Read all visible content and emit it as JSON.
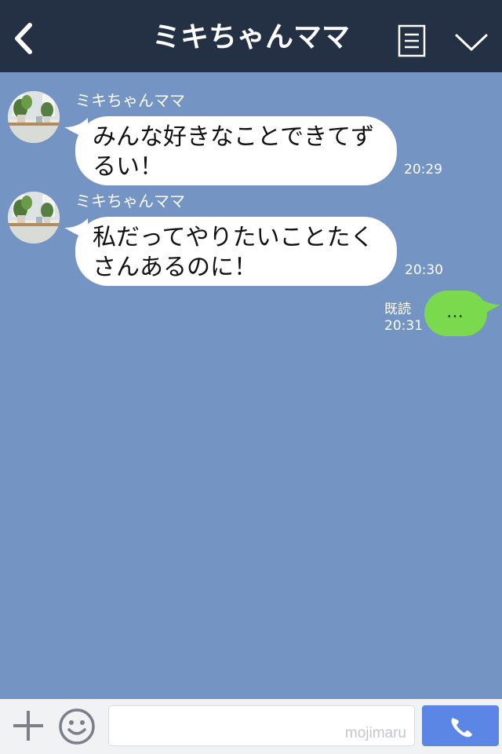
{
  "header": {
    "title": "ミキちゃんママ",
    "back_icon": "chevron-left-icon",
    "menu_icon": "menu-list-icon",
    "collapse_icon": "chevron-down-icon"
  },
  "messages": [
    {
      "sender": "ミキちゃんママ",
      "lines": [
        "みんな好きなことできてず",
        "るい！"
      ],
      "time": "20:29"
    },
    {
      "sender": "ミキちゃんママ",
      "lines": [
        "私だってやりたいことたく",
        "さんあるのに！"
      ],
      "time": "20:30"
    }
  ],
  "outgoing": {
    "text": "…",
    "read_label": "既読",
    "time": "20:31"
  },
  "input_bar": {
    "watermark": "mojimaru",
    "plus_icon": "plus-icon",
    "emoji_icon": "emoji-icon",
    "call_icon": "phone-icon"
  },
  "colors": {
    "header_bg": "#243044",
    "chat_bg": "#7495c4",
    "outgoing_bubble": "#7bd94e",
    "call_button": "#5b86e6"
  }
}
